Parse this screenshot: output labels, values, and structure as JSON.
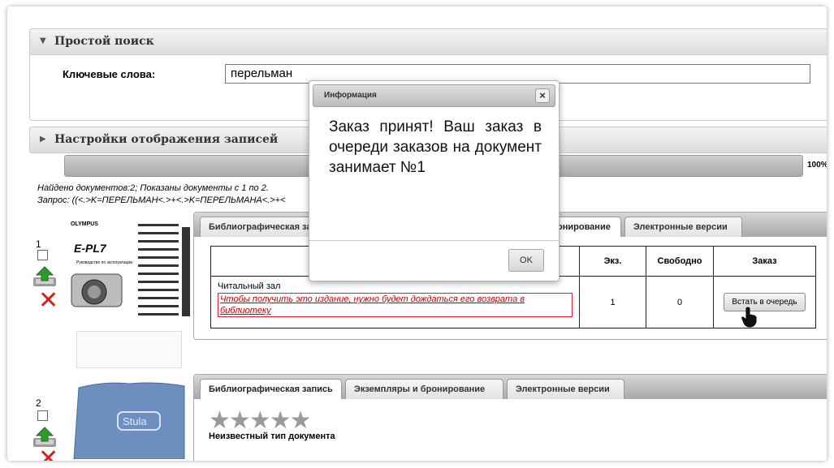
{
  "search": {
    "section_title": "Простой поиск",
    "keywords_label": "Ключевые слова:",
    "keywords_value": "перельман"
  },
  "display_settings": {
    "section_title": "Настройки отображения записей"
  },
  "progress": {
    "percent_value": 100,
    "label": "100%"
  },
  "results": {
    "found_text": "Найдено документов:2; Показаны документы с 1 по 2.",
    "query_text": "Запрос: ((<.>K=ПЕРЕЛЬМАН<.>+<.>K=ПЕРЕЛЬМАНА<.>+<"
  },
  "records": [
    {
      "number": "1",
      "tabs": [
        "Библиографическая за",
        "онирование",
        "Электронные версии"
      ],
      "table": {
        "headers": [
          "Экз.",
          "Свободно",
          "Заказ"
        ],
        "holder": "Читальный зал",
        "warning": "Чтобы получить это издание, нужно будет дождаться его возврата в библиотеку",
        "copies": "1",
        "free": "0",
        "action": "Встать в очередь"
      },
      "thumb": {
        "brand": "OLYMPUS",
        "model": "E-PL7",
        "subtitle": "Руководство по эксплуатации"
      }
    },
    {
      "number": "2",
      "tabs": [
        "Библиографическая запись",
        "Экземпляры и бронирование",
        "Электронные версии"
      ],
      "doc_type": "Неизвестный тип документа",
      "rating_stars": 5,
      "thumb": {
        "label": "Stula"
      }
    }
  ],
  "modal": {
    "title": "Информация",
    "message": "Заказ принят! Ваш заказ в очереди заказов на документ занимает №1",
    "ok_label": "OK",
    "close_glyph": "×"
  },
  "colors": {
    "accent_red": "#d7201b",
    "warning_red": "#c00000"
  },
  "icons": [
    "collapse-triangle-icon",
    "expand-triangle-icon",
    "upload-arrow-icon",
    "delete-x-icon",
    "cursor-hand-icon",
    "star-icon",
    "close-icon"
  ]
}
